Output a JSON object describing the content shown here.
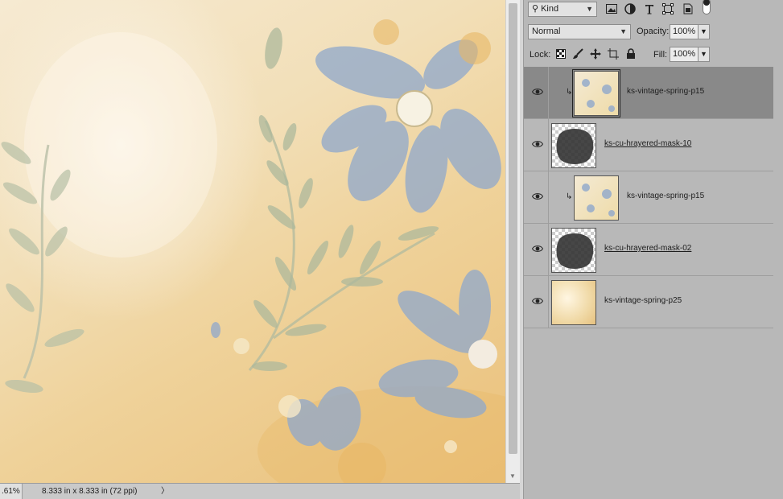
{
  "canvas": {
    "zoom_text": ".61%",
    "doc_info": "8.333 in x 8.333 in (72 ppi)",
    "status_arrow": "〉"
  },
  "layers_panel": {
    "filter": {
      "label": "Kind"
    },
    "filter_icons": [
      "image-filter-icon",
      "adjustment-filter-icon",
      "type-filter-icon",
      "shape-filter-icon",
      "smart-object-filter-icon",
      "filter-toggle-icon"
    ],
    "blend_mode": "Normal",
    "opacity_label": "Opacity:",
    "opacity_value": "100%",
    "lock_label": "Lock:",
    "lock_icons": [
      "lock-transparency-icon",
      "lock-pixels-icon",
      "lock-position-icon",
      "lock-artboard-icon",
      "lock-all-icon"
    ],
    "fill_label": "Fill:",
    "fill_value": "100%",
    "layers": [
      {
        "name": "ks-vintage-spring-p15",
        "clipped": true,
        "selected": true,
        "thumb": "paper",
        "underline": false
      },
      {
        "name": "ks-cu-hrayered-mask-10",
        "clipped": false,
        "selected": false,
        "thumb": "mask",
        "underline": true
      },
      {
        "name": "ks-vintage-spring-p15",
        "clipped": true,
        "selected": false,
        "thumb": "paper",
        "underline": false
      },
      {
        "name": "ks-cu-hrayered-mask-02",
        "clipped": false,
        "selected": false,
        "thumb": "mask",
        "underline": true
      },
      {
        "name": "ks-vintage-spring-p25",
        "clipped": false,
        "selected": false,
        "thumb": "warm",
        "underline": false
      }
    ]
  }
}
